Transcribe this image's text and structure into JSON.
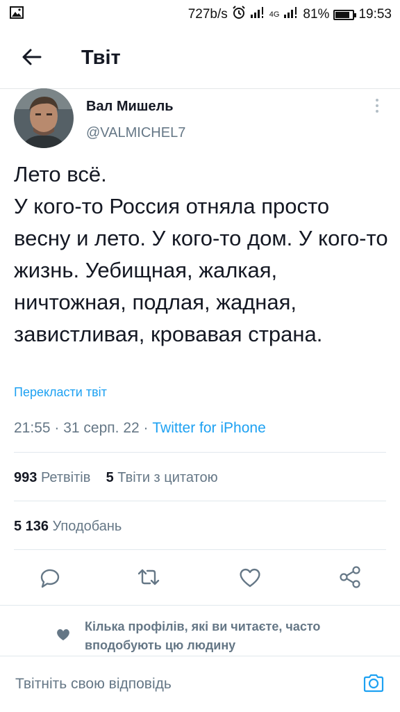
{
  "status_bar": {
    "speed": "727b/s",
    "network": "4G",
    "battery": "81%",
    "time": "19:53",
    "battery_level": 0.81,
    "icons": [
      "gallery-notification-icon",
      "alarm-icon",
      "signal-icon",
      "signal-4g-icon",
      "battery-icon"
    ]
  },
  "header": {
    "title": "Твіт"
  },
  "tweet": {
    "author_name": "Вал Мишель",
    "author_handle": "@VALMICHEL7",
    "text": "Лето всё.\nУ кого-то Россия отняла просто весну и лето. У кого-то дом. У кого-то жизнь. Уебищная, жалкая, ничтожная, подлая, жадная, завистливая, кровавая страна.",
    "translate_label": "Перекласти твіт",
    "time": "21:55",
    "date": "31 серп. 22",
    "source": "Twitter for iPhone",
    "retweets_count": "993",
    "retweets_label": "Ретвітів",
    "quotes_count": "5",
    "quotes_label": "Твіти з цитатою",
    "likes_count": "5 136",
    "likes_label": "Уподобань"
  },
  "social_context": "Кілька профілів, які ви читаєте, часто вподобують цю людину",
  "reply": {
    "placeholder": "Твітніть свою відповідь"
  },
  "colors": {
    "accent": "#1da1f2",
    "text": "#141823",
    "muted": "#657786",
    "divider": "#e1e8ed"
  }
}
